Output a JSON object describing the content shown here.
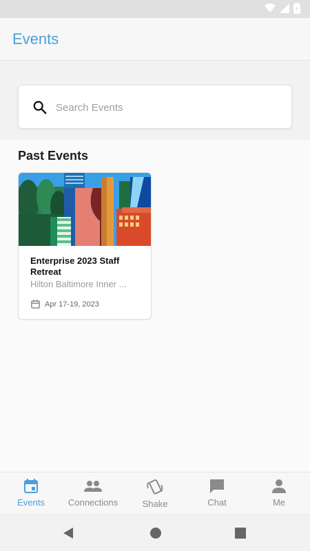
{
  "app": {
    "title": "Events"
  },
  "search": {
    "placeholder": "Search Events",
    "value": ""
  },
  "past_events": {
    "title": "Past Events",
    "items": [
      {
        "name": "Enterprise 2023 Staff Retreat",
        "venue": "Hilton Baltimore Inner ...",
        "dates": "Apr 17-19, 2023"
      }
    ]
  },
  "bottom_nav": {
    "items": [
      {
        "label": "Events",
        "icon": "calendar-icon",
        "active": true
      },
      {
        "label": "Connections",
        "icon": "people-icon",
        "active": false
      },
      {
        "label": "Shake",
        "icon": "shake-phone-icon",
        "active": false
      },
      {
        "label": "Chat",
        "icon": "chat-icon",
        "active": false
      },
      {
        "label": "Me",
        "icon": "person-icon",
        "active": false
      }
    ]
  },
  "colors": {
    "accent": "#4a9fdc",
    "inactive": "#8a8a8a"
  }
}
